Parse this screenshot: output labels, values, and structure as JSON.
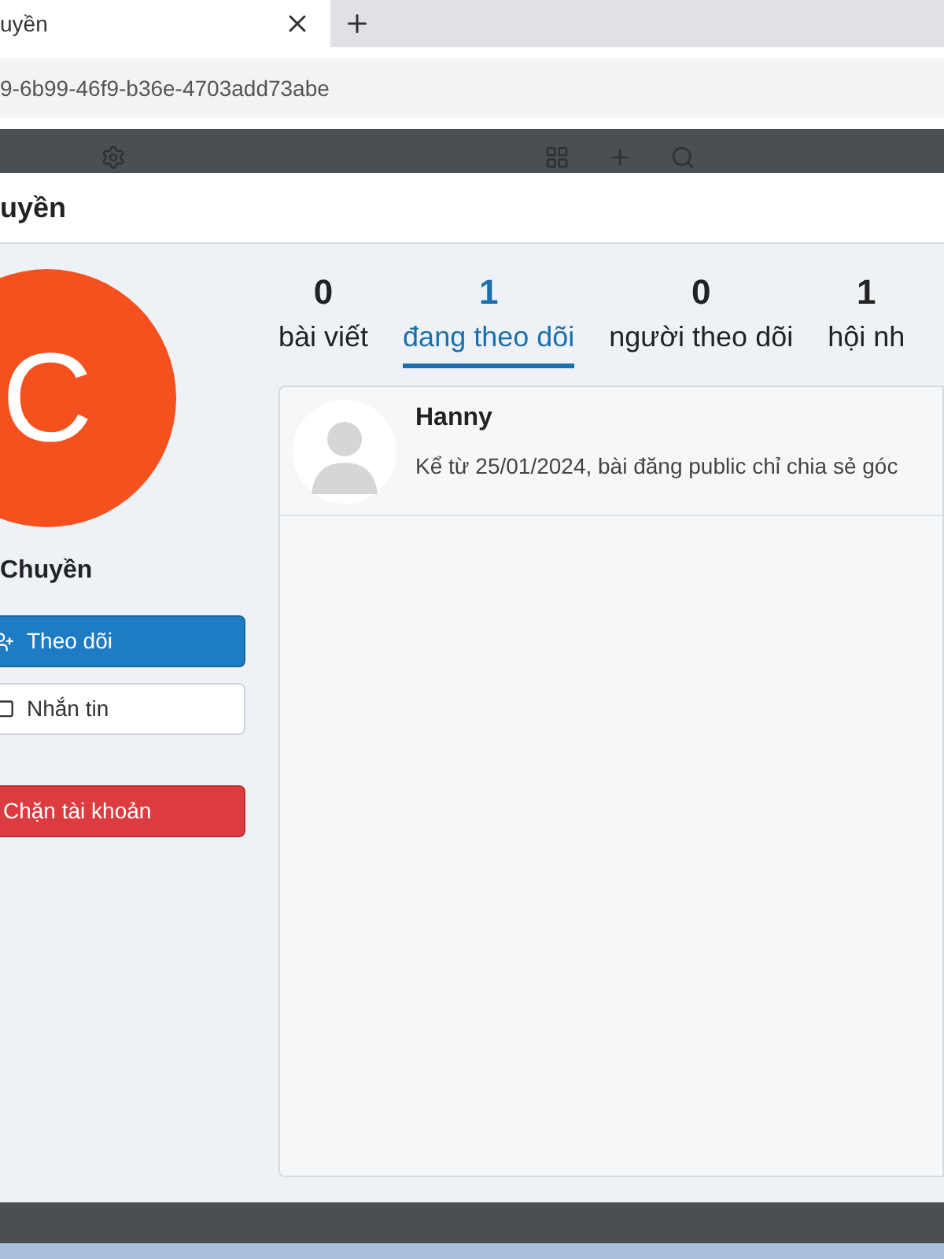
{
  "browser": {
    "tab_title": "uyền",
    "address": "9-6b99-46f9-b36e-4703add73abe"
  },
  "dialog": {
    "title": "uyền"
  },
  "profile": {
    "avatar_letter": "C",
    "name": "Chuyền",
    "buttons": [
      {
        "kind": "primary",
        "label": "Theo dõi"
      },
      {
        "kind": "default",
        "label": "Nhắn tin"
      },
      {
        "kind": "danger",
        "label": "Chặn tài khoản"
      }
    ]
  },
  "stats": [
    {
      "count": "0",
      "label": "bài viết",
      "selected": false
    },
    {
      "count": "1",
      "label": "đang theo dõi",
      "selected": true
    },
    {
      "count": "0",
      "label": "người theo dõi",
      "selected": false
    },
    {
      "count": "1",
      "label": "hội nh",
      "selected": false
    }
  ],
  "following": [
    {
      "name": "Hanny",
      "description": "Kể từ 25/01/2024, bài đăng public chỉ chia sẻ góc"
    }
  ]
}
